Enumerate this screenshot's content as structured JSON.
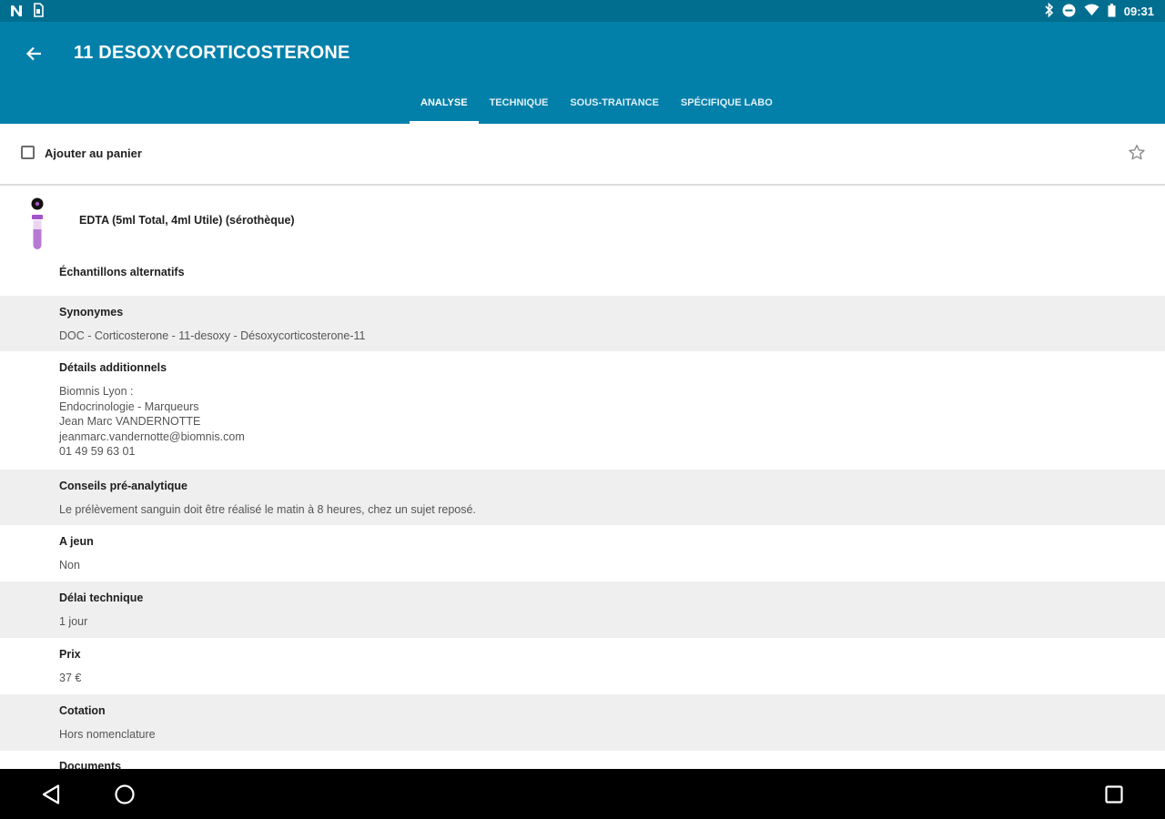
{
  "status_bar": {
    "left_icons": [
      "notification-n-icon",
      "sim-card-icon"
    ],
    "right_icons": [
      "bluetooth-icon",
      "do-not-disturb-icon",
      "wifi-icon",
      "battery-icon"
    ],
    "time": "09:31"
  },
  "app_bar": {
    "title": "11 DESOXYCORTICOSTERONE",
    "tabs": [
      {
        "label": "ANALYSE",
        "active": true
      },
      {
        "label": "TECHNIQUE",
        "active": false
      },
      {
        "label": "SOUS-TRAITANCE",
        "active": false
      },
      {
        "label": "SPÉCIFIQUE LABO",
        "active": false
      }
    ]
  },
  "cart": {
    "label": "Ajouter au panier"
  },
  "sample": {
    "tube_label": "EDTA (5ml Total, 4ml Utile) (sérothèque)",
    "tube_color": "#a452c7",
    "alternatives_label": "Échantillons alternatifs"
  },
  "sections": [
    {
      "label": "Synonymes",
      "value": "DOC - Corticosterone - 11-desoxy - Désoxycorticosterone-11"
    },
    {
      "label": "Détails additionnels",
      "value": "Biomnis Lyon :\nEndocrinologie - Marqueurs\nJean Marc VANDERNOTTE\njeanmarc.vandernotte@biomnis.com\n01 49 59 63 01"
    },
    {
      "label": "Conseils pré-analytique",
      "value": "Le prélèvement sanguin doit être réalisé le matin à 8 heures, chez un  sujet reposé."
    },
    {
      "label": "A jeun",
      "value": "Non"
    },
    {
      "label": "Délai technique",
      "value": "1 jour"
    },
    {
      "label": "Prix",
      "value": "37 €"
    },
    {
      "label": "Cotation",
      "value": "Hors nomenclature"
    },
    {
      "label": "Documents",
      "value": ""
    }
  ],
  "colors": {
    "status_bar": "#016e8f",
    "app_bar": "#0280aa",
    "section_grey": "#efefef"
  }
}
